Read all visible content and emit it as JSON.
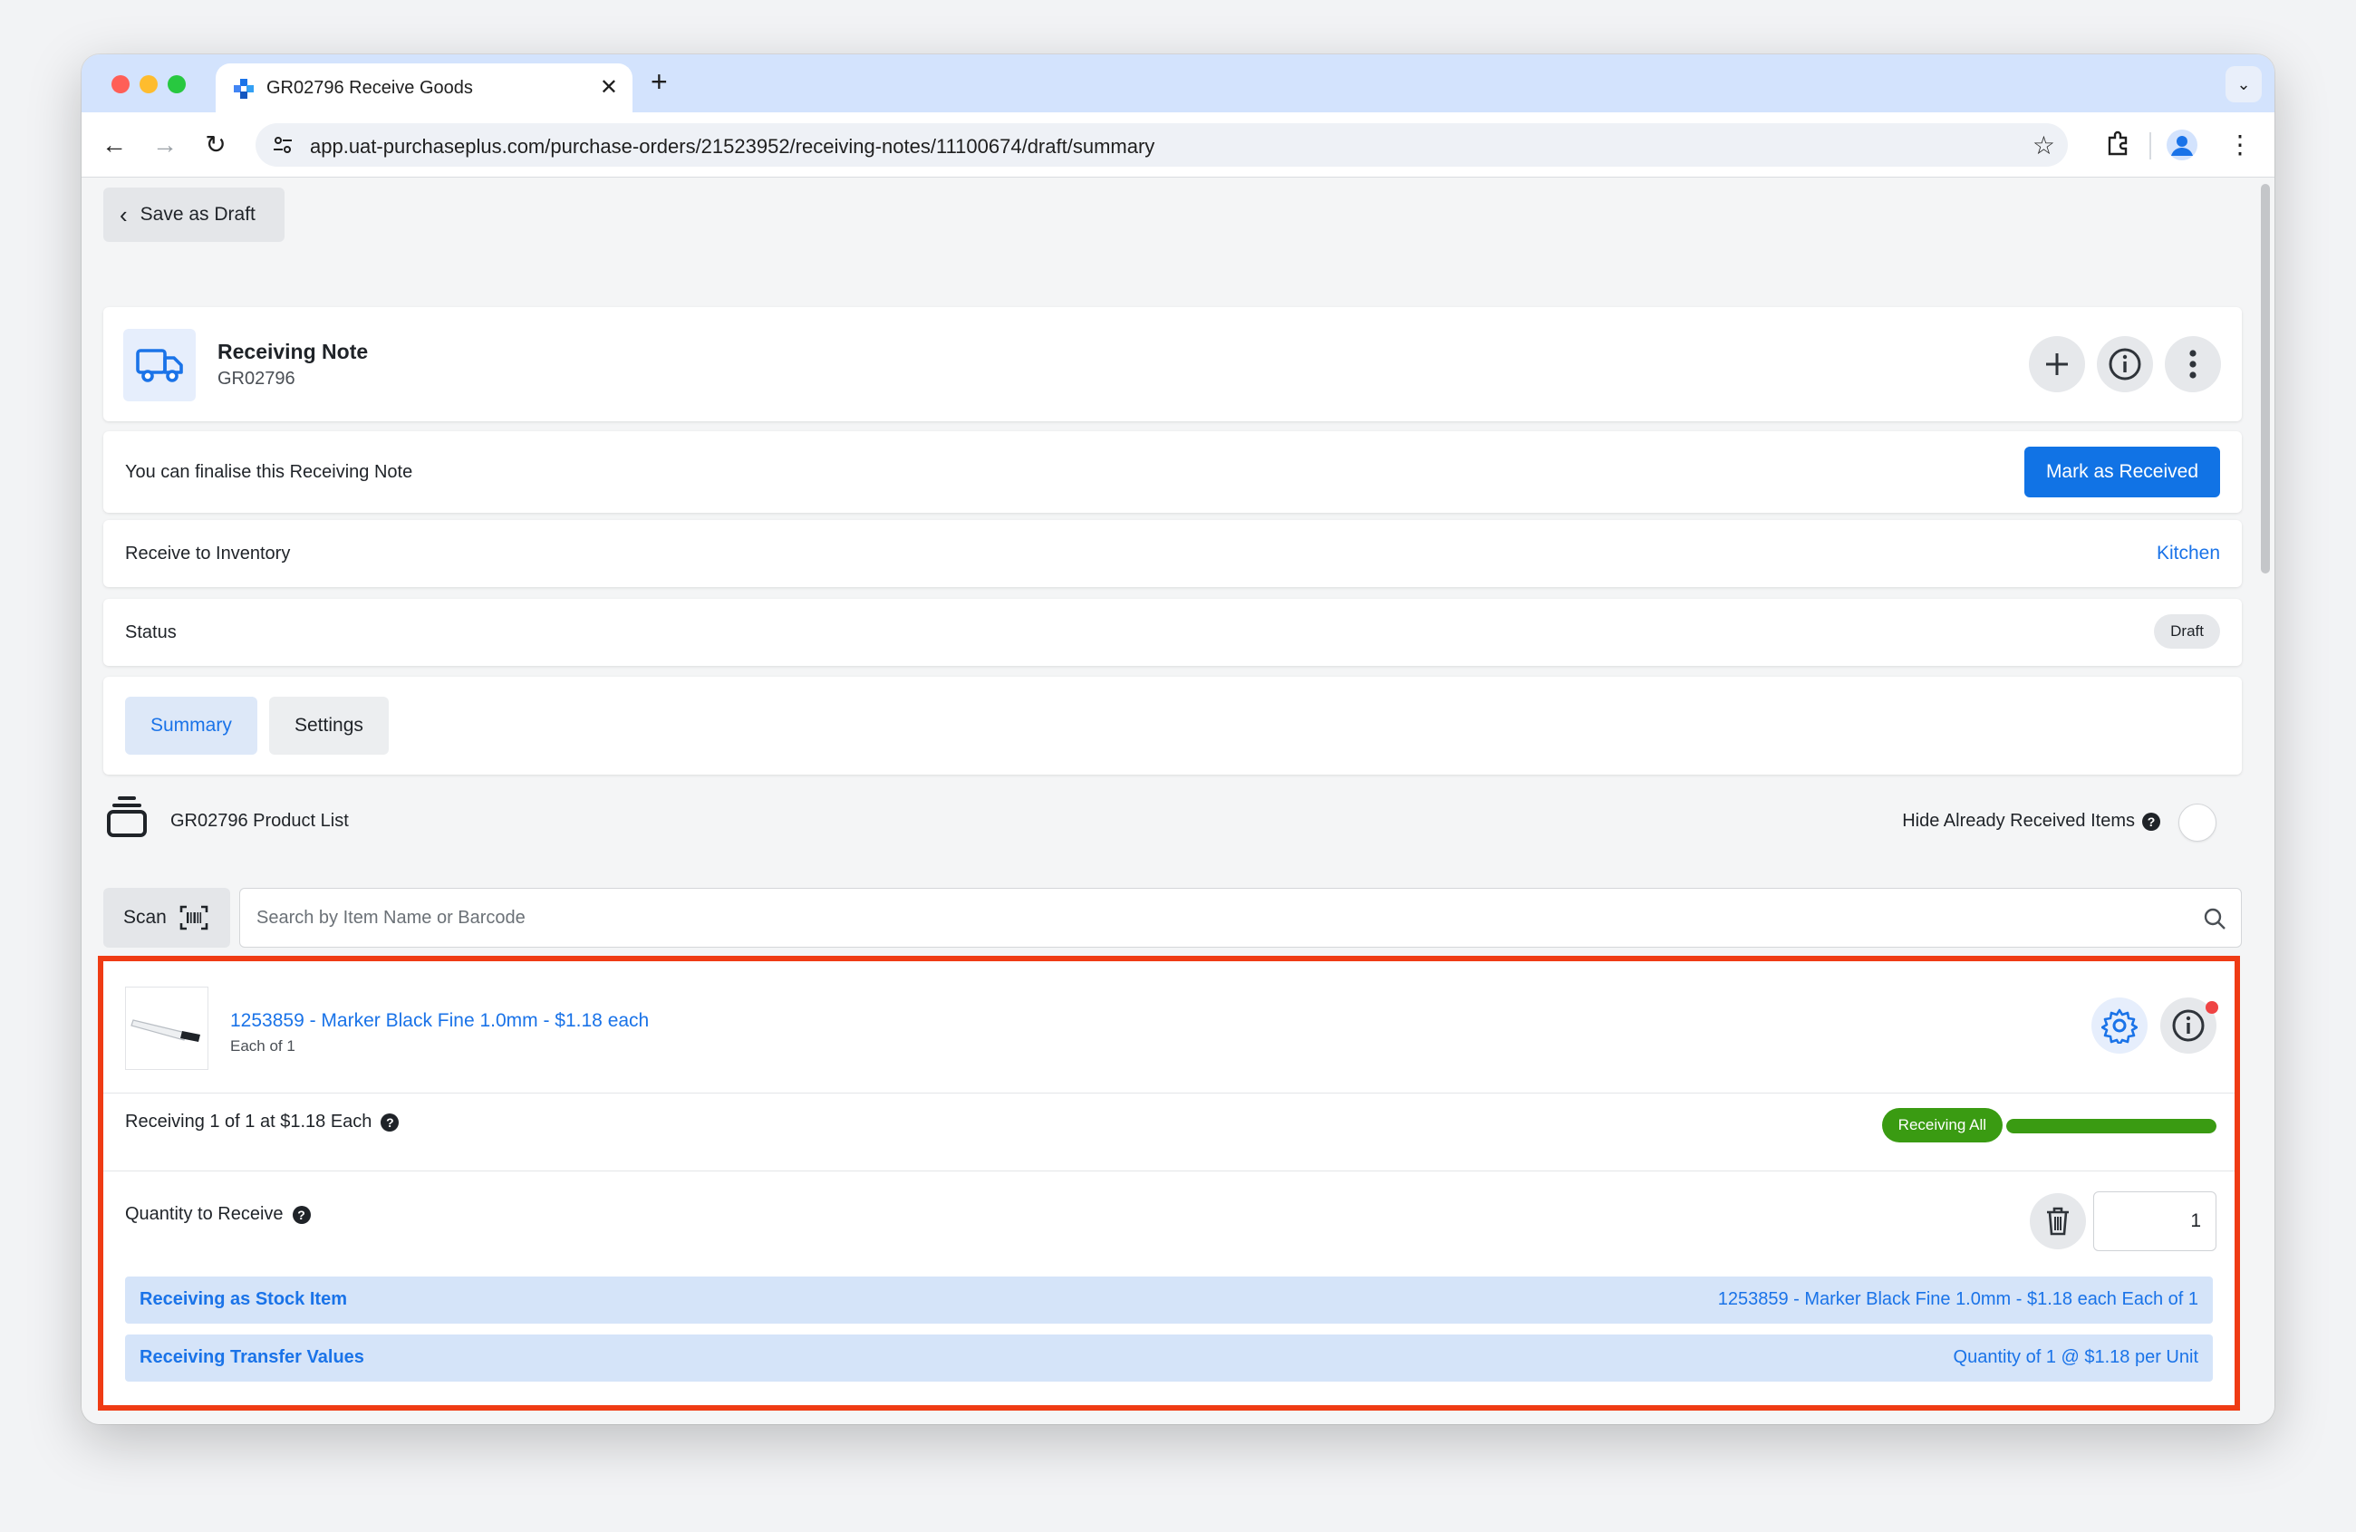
{
  "browser": {
    "tab_title": "GR02796 Receive Goods",
    "new_tab_label": "+",
    "url": "app.uat-purchaseplus.com/purchase-orders/21523952/receiving-notes/11100674/draft/summary"
  },
  "header": {
    "back_label": "Save as Draft"
  },
  "note": {
    "title": "Receiving Note",
    "number": "GR02796"
  },
  "finalise": {
    "text": "You can finalise this Receiving Note",
    "button_label": "Mark as Received"
  },
  "inventory": {
    "label": "Receive to Inventory",
    "value": "Kitchen"
  },
  "status": {
    "label": "Status",
    "value": "Draft"
  },
  "tabs": [
    {
      "label": "Summary",
      "active": true
    },
    {
      "label": "Settings",
      "active": false
    }
  ],
  "product_list": {
    "title": "GR02796 Product List",
    "hide_label": "Hide Already Received Items",
    "scan_label": "Scan",
    "search_placeholder": "Search by Item Name or Barcode"
  },
  "item": {
    "title": "1253859 - Marker Black Fine 1.0mm - $1.18 each",
    "unit": "Each of 1",
    "receiving_text": "Receiving 1 of 1 at $1.18 Each",
    "receiving_badge": "Receiving All",
    "progress_fraction": 1.0,
    "quantity_label": "Quantity to Receive",
    "quantity_value": "1",
    "stock_label": "Receiving as Stock Item",
    "stock_value": "1253859 - Marker Black Fine 1.0mm - $1.18 each Each of 1",
    "transfer_label": "Receiving Transfer Values",
    "transfer_value": "Quantity of 1 @ $1.18 per Unit"
  },
  "colors": {
    "primary": "#1173e5",
    "link": "#1a73e8",
    "success": "#3a9b12",
    "highlight_border": "#ef3b14"
  }
}
